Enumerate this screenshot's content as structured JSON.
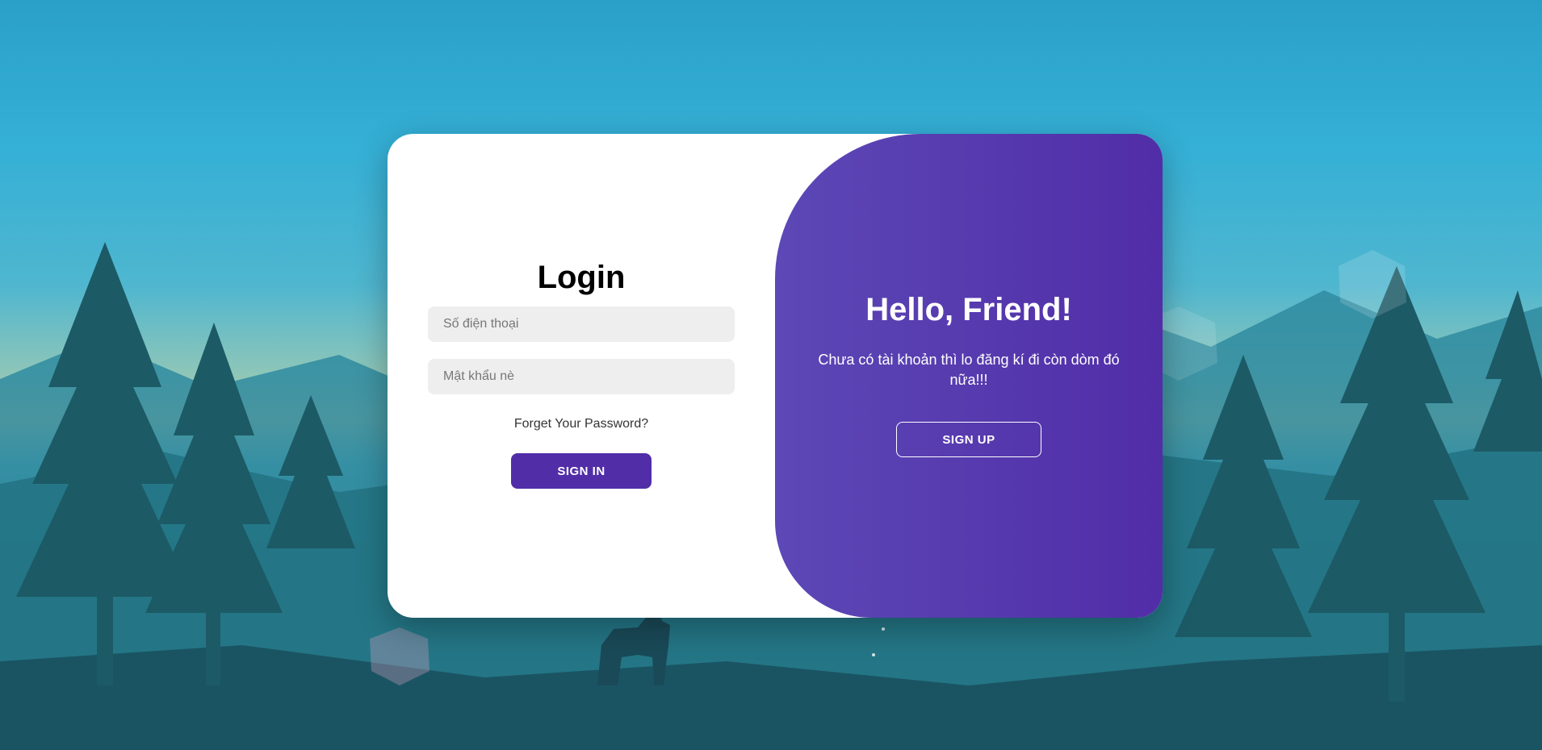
{
  "signin": {
    "title": "Login",
    "phone_placeholder": "Số điện thoại",
    "password_placeholder": "Mật khẩu nè",
    "forgot_label": "Forget Your Password?",
    "submit_label": "SIGN IN"
  },
  "toggle": {
    "title": "Hello, Friend!",
    "text": "Chưa có tài khoản thì lo đăng kí đi còn dòm đó nữa!!!",
    "signup_label": "SIGN UP"
  },
  "colors": {
    "accent": "#512da8",
    "panel_gradient_start": "#5c48b6",
    "panel_gradient_end": "#512da8",
    "input_background": "#eeeeee",
    "card_background": "#ffffff"
  }
}
